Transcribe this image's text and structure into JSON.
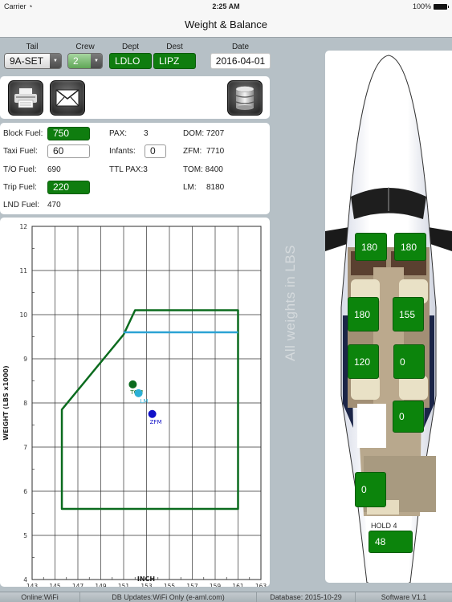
{
  "status_bar": {
    "carrier": "Carrier",
    "time": "2:25 AM",
    "battery": "100%"
  },
  "nav": {
    "title": "Weight & Balance"
  },
  "header": {
    "tail": {
      "label": "Tail",
      "value": "9A-SET"
    },
    "crew": {
      "label": "Crew",
      "value": "2"
    },
    "dept": {
      "label": "Dept",
      "value": "LDLO"
    },
    "dest": {
      "label": "Dest",
      "value": "LIPZ"
    },
    "date": {
      "label": "Date",
      "value": "2016-04-01"
    }
  },
  "toolbar": {
    "print_icon": "printer-icon",
    "mail_icon": "envelope-icon",
    "database_icon": "database-icon"
  },
  "fuel": {
    "block_label": "Block Fuel:",
    "block_value": "750",
    "taxi_label": "Taxi Fuel:",
    "taxi_value": "60",
    "to_label": "T/O Fuel:",
    "to_value": "690",
    "trip_label": "Trip Fuel:",
    "trip_value": "220",
    "lnd_label": "LND Fuel:",
    "lnd_value": "470"
  },
  "pax": {
    "pax_label": "PAX:",
    "pax_value": "3",
    "infants_label": "Infants:",
    "infants_value": "0",
    "ttl_label": "TTL PAX:3"
  },
  "mass": {
    "dom": "DOM: 7207",
    "zfm_label": "ZFM:",
    "zfm_value": "7710",
    "tom": "TOM: 8400",
    "lm_label": "LM:",
    "lm_value": "8180"
  },
  "colors": {
    "accent_green": "#0f7d0f",
    "envelope": "#0b6b1e",
    "landing_line": "#2ba3d4",
    "tom": "#0b6b1e",
    "lm": "#2bb0d6",
    "zfm": "#1010c8"
  },
  "chart_data": {
    "type": "scatter",
    "title": "",
    "xlabel": "INCH",
    "ylabel": "WEIGHT (LBS x1000)",
    "xlim": [
      143,
      163
    ],
    "ylim": [
      4,
      12
    ],
    "x_ticks": [
      143,
      145,
      147,
      149,
      151,
      153,
      155,
      157,
      159,
      161,
      163
    ],
    "y_ticks": [
      4,
      5,
      6,
      7,
      8,
      9,
      10,
      11,
      12
    ],
    "grid": true,
    "envelope": {
      "name": "CG envelope",
      "points": [
        [
          145.6,
          5.6
        ],
        [
          145.6,
          7.85
        ],
        [
          151.0,
          9.55
        ],
        [
          152.0,
          10.1
        ],
        [
          161.0,
          10.1
        ],
        [
          161.0,
          5.6
        ]
      ]
    },
    "landing_limit": {
      "name": "Max landing weight",
      "points": [
        [
          151.0,
          9.6
        ],
        [
          161.0,
          9.6
        ]
      ]
    },
    "series": [
      {
        "name": "TOM",
        "x": 151.8,
        "y": 8.42
      },
      {
        "name": "LM",
        "x": 152.3,
        "y": 8.22
      },
      {
        "name": "ZFM",
        "x": 153.5,
        "y": 7.75
      }
    ]
  },
  "aircraft": {
    "note": "All weights in LBS",
    "seats": [
      {
        "id": "crew-left",
        "value": "180"
      },
      {
        "id": "crew-right",
        "value": "180"
      },
      {
        "id": "pax-1-left",
        "value": "180"
      },
      {
        "id": "pax-1-right",
        "value": "155"
      },
      {
        "id": "pax-2-left",
        "value": "120"
      },
      {
        "id": "pax-2-right",
        "value": "0"
      },
      {
        "id": "pax-3-right",
        "value": "0"
      },
      {
        "id": "aft-cabin",
        "value": "0"
      }
    ],
    "hold_label": "HOLD 4",
    "hold_value": "48"
  },
  "footer": {
    "online": "Online:WiFi",
    "db_updates": "DB Updates:WiFi Only   (e-aml.com)",
    "database": "Database: 2015-10-29",
    "software": "Software V1.1"
  }
}
